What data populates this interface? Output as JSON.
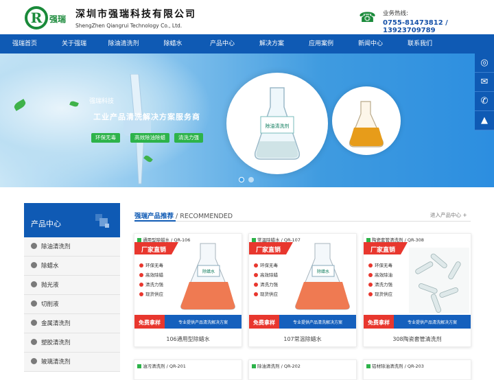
{
  "header": {
    "logo_text": "强瑞",
    "company_cn": "深圳市强瑞科技有限公司",
    "company_en": "ShengZhen Qiangrui Technology Co., Ltd.",
    "hotline_label": "业务热线:",
    "hotline_number": "0755-81473812 / 13923709789"
  },
  "nav": [
    "强瑞首页",
    "关于强瑞",
    "除油清洗剂",
    "除蜡水",
    "产品中心",
    "解决方案",
    "应用案例",
    "新闻中心",
    "联系我们"
  ],
  "banner": {
    "brand": "强瑞科技",
    "slogan": "工业产品清洗解决方案服务商",
    "tags": [
      "环保无毒",
      "高效除油除蜡",
      "清洗力强"
    ],
    "flask_label": "除油清洗剂",
    "slide_count": 2,
    "active_slide": 1
  },
  "float_icons": [
    "qq-icon",
    "wechat-icon",
    "phone-icon"
  ],
  "sidebar": {
    "title": "产品中心",
    "items": [
      "除油清洗剂",
      "除蜡水",
      "抛光液",
      "切削液",
      "金属清洗剂",
      "塑胶清洗剂",
      "玻璃清洗剂"
    ]
  },
  "section": {
    "title": "强瑞产品推荐",
    "subtitle": " / RECOMMENDED",
    "more": "进入产品中心 +"
  },
  "products": [
    {
      "tag": "通用型除蜡水 / QR-106",
      "name": "106通用型除蜡水",
      "flask_label": "除蜡水",
      "features": [
        "环保无毒",
        "高效除蜡",
        "清洗力强",
        "现货供应"
      ]
    },
    {
      "tag": "常温除蜡水 / QR-107",
      "name": "107常温除蜡水",
      "flask_label": "除蜡水",
      "features": [
        "环保无毒",
        "高效除蜡",
        "清洗力强",
        "现货供应"
      ]
    },
    {
      "tag": "陶瓷套管清洗剂 / QR-308",
      "name": "308陶瓷套管清洗剂",
      "flask_label": "",
      "features": [
        "环保无毒",
        "高效除油",
        "清洗力强",
        "现货供应"
      ]
    }
  ],
  "card_common": {
    "banner_text": "厂家直销",
    "free_text": "免费拿样",
    "service_text": "专业提供产品清洗解决方案"
  },
  "products_row2": [
    "油污清洗剂 / QR-201",
    "除油清洗剂 / QR-202",
    "铝材除油清洗剂 / QR-203"
  ],
  "colors": {
    "primary": "#0f5ab4",
    "green": "#2db34a",
    "red": "#e8372e"
  }
}
